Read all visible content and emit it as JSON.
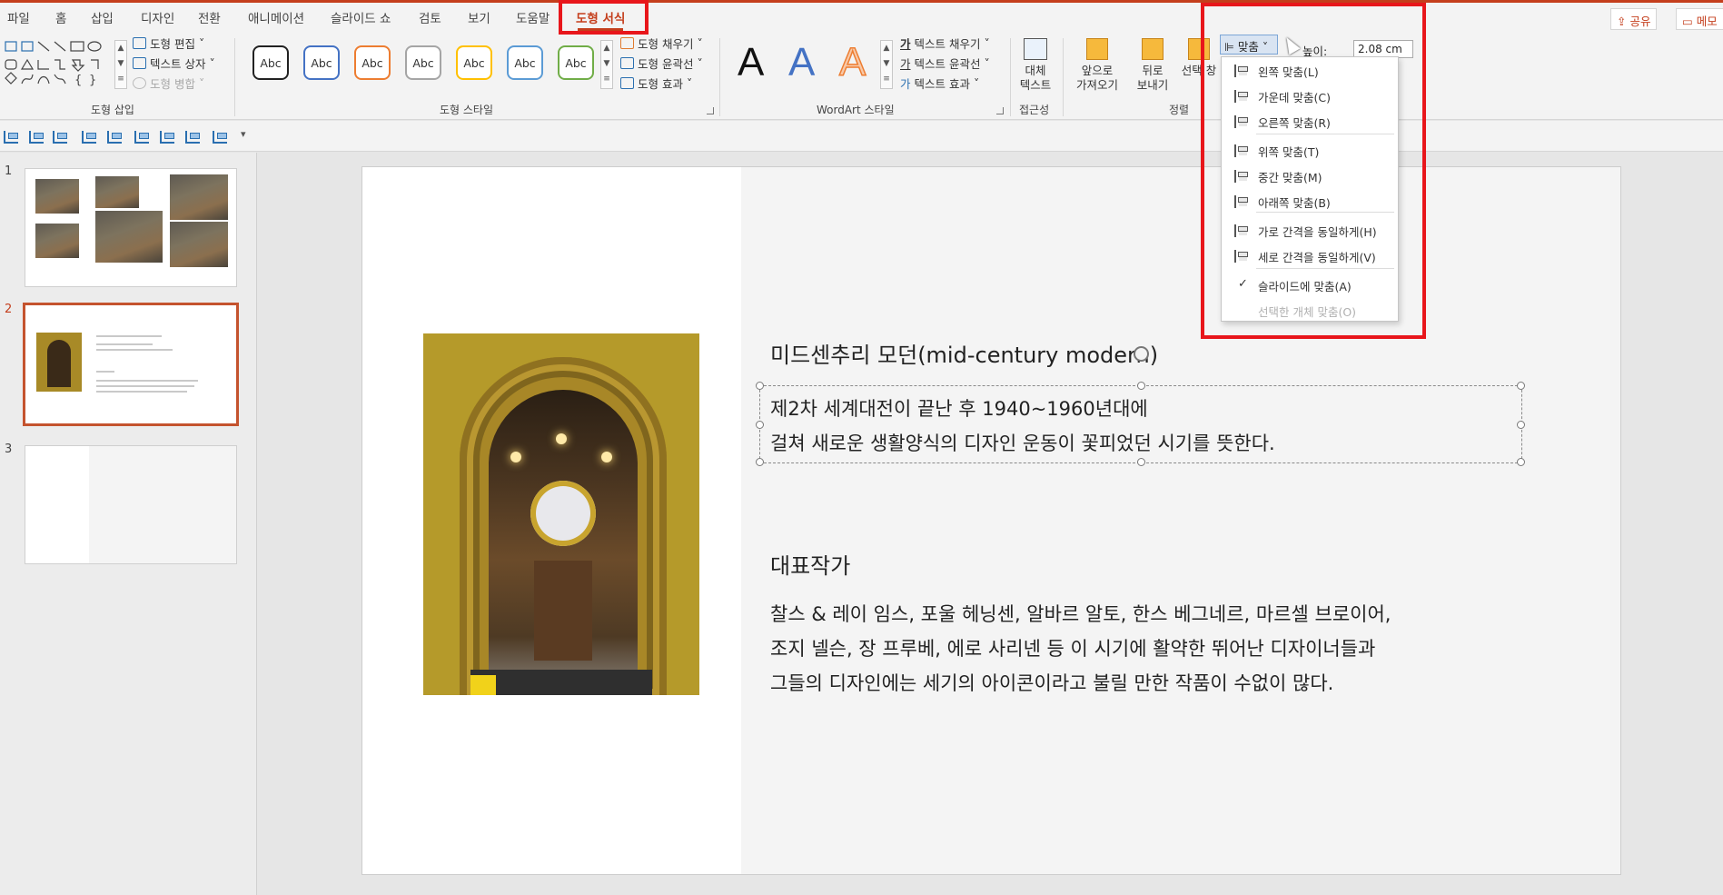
{
  "menu": {
    "tabs": [
      "파일",
      "홈",
      "삽입",
      "디자인",
      "전환",
      "애니메이션",
      "슬라이드 쇼",
      "검토",
      "보기",
      "도움말",
      "도형 서식"
    ],
    "share": "공유",
    "comments": "메모"
  },
  "ribbon": {
    "insert_shapes": {
      "edit_shape": "도형 편집",
      "text_box": "텍스트 상자",
      "merge_shapes": "도형 병합",
      "label": "도형 삽입"
    },
    "shape_styles": {
      "preset_label": "Abc",
      "preset_colors": [
        "#222222",
        "#4472c4",
        "#ed7d31",
        "#a5a5a5",
        "#ffc000",
        "#5b9bd5",
        "#70ad47"
      ],
      "fill": "도형 채우기",
      "outline": "도형 윤곽선",
      "effects": "도형 효과",
      "label": "도형 스타일"
    },
    "wordart": {
      "letter": "A",
      "colors": [
        "#111111",
        "#4472c4",
        "#ed7d31"
      ],
      "text_fill": "텍스트 채우기",
      "text_outline": "텍스트 윤곽선",
      "text_effects": "텍스트 효과",
      "label": "WordArt 스타일"
    },
    "accessibility": {
      "alt_text_line1": "대체",
      "alt_text_line2": "텍스트",
      "label": "접근성"
    },
    "arrange": {
      "bring_forward_line1": "앞으로",
      "bring_forward_line2": "가져오기",
      "send_backward_line1": "뒤로",
      "send_backward_line2": "보내기",
      "selection_pane": "선택 창",
      "label": "정렬",
      "align_button": "맞춤"
    },
    "size": {
      "height_label": "높이:",
      "height_value": "2.08 cm"
    }
  },
  "align_menu": {
    "items": [
      {
        "label": "왼쪽 맞춤(L)",
        "enabled": true
      },
      {
        "label": "가운데 맞춤(C)",
        "enabled": true
      },
      {
        "label": "오른쪽 맞춤(R)",
        "enabled": true
      },
      {
        "label": "위쪽 맞춤(T)",
        "enabled": true
      },
      {
        "label": "중간 맞춤(M)",
        "enabled": true
      },
      {
        "label": "아래쪽 맞춤(B)",
        "enabled": true
      },
      {
        "label": "가로 간격을 동일하게(H)",
        "enabled": true
      },
      {
        "label": "세로 간격을 동일하게(V)",
        "enabled": true
      },
      {
        "label": "슬라이드에 맞춤(A)",
        "enabled": true,
        "checked": true
      },
      {
        "label": "선택한 개체 맞춤(O)",
        "enabled": false
      }
    ],
    "check_mark": "✓"
  },
  "thumbnails": {
    "numbers": [
      "1",
      "2",
      "3"
    ],
    "selected": "2"
  },
  "slide": {
    "title": "미드센추리 모던(mid-century modern)",
    "body_line1": "제2차 세계대전이 끝난 후 1940~1960년대에",
    "body_line2": "걸쳐 새로운 생활양식의 디자인 운동이 꽃피었던 시기를 뜻한다.",
    "rep_title": "대표작가",
    "rep_line1": "찰스 & 레이 임스, 포울 헤닝센, 알바르 알토, 한스 베그네르, 마르셀 브로이어,",
    "rep_line2": "조지 넬슨, 장 프루베, 에로 사리넨 등 이 시기에 활약한 뛰어난 디자이너들과",
    "rep_line3": "그들의 디자인에는 세기의 아이콘이라고 불릴 만한 작품이 수없이 많다."
  },
  "colors": {
    "accent": "#c43e1c",
    "annotation_red": "#e8161b"
  }
}
